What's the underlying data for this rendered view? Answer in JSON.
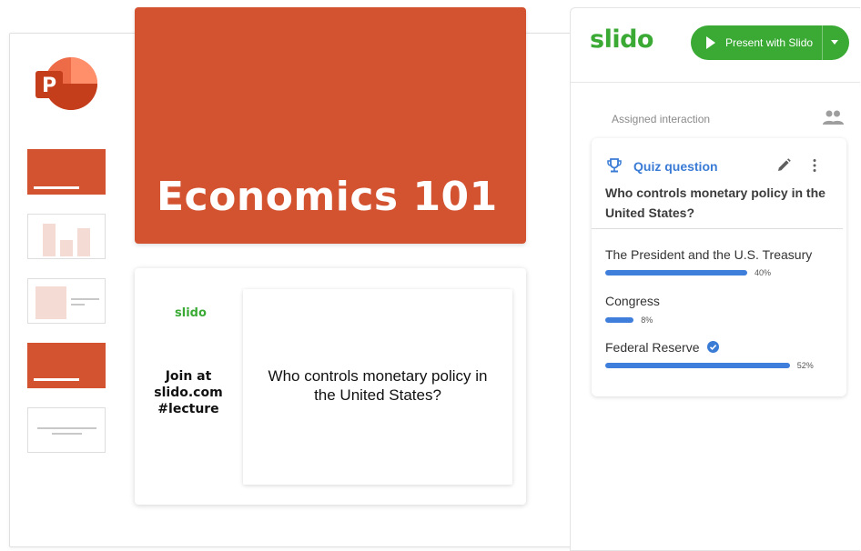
{
  "presentation": {
    "title_slide": "Economics 101",
    "slido_slide": {
      "logo": "slido",
      "join_lines": [
        "Join at",
        "slido.com",
        "#lecture"
      ],
      "question": "Who controls monetary policy in the United States?"
    }
  },
  "panel": {
    "logo": "slido",
    "present_button": "Present with Slido",
    "assigned_label": "Assigned interaction",
    "card": {
      "type_label": "Quiz question",
      "question": "Who controls monetary policy in the United States?",
      "options": [
        {
          "label": "The President and the U.S. Treasury",
          "percent_text": "40%",
          "percent": 40,
          "correct": false
        },
        {
          "label": "Congress",
          "percent_text": "8%",
          "percent": 8,
          "correct": false
        },
        {
          "label": "Federal Reserve",
          "percent_text": "52%",
          "percent": 52,
          "correct": true
        }
      ]
    }
  },
  "colors": {
    "powerpoint_orange": "#d35230",
    "slido_green": "#3aaa35",
    "accent_blue": "#3f7edb"
  },
  "icons": [
    "powerpoint-icon",
    "play-icon",
    "chevron-down-icon",
    "people-icon",
    "trophy-icon",
    "pencil-icon",
    "more-vert-icon",
    "check-circle-icon"
  ]
}
